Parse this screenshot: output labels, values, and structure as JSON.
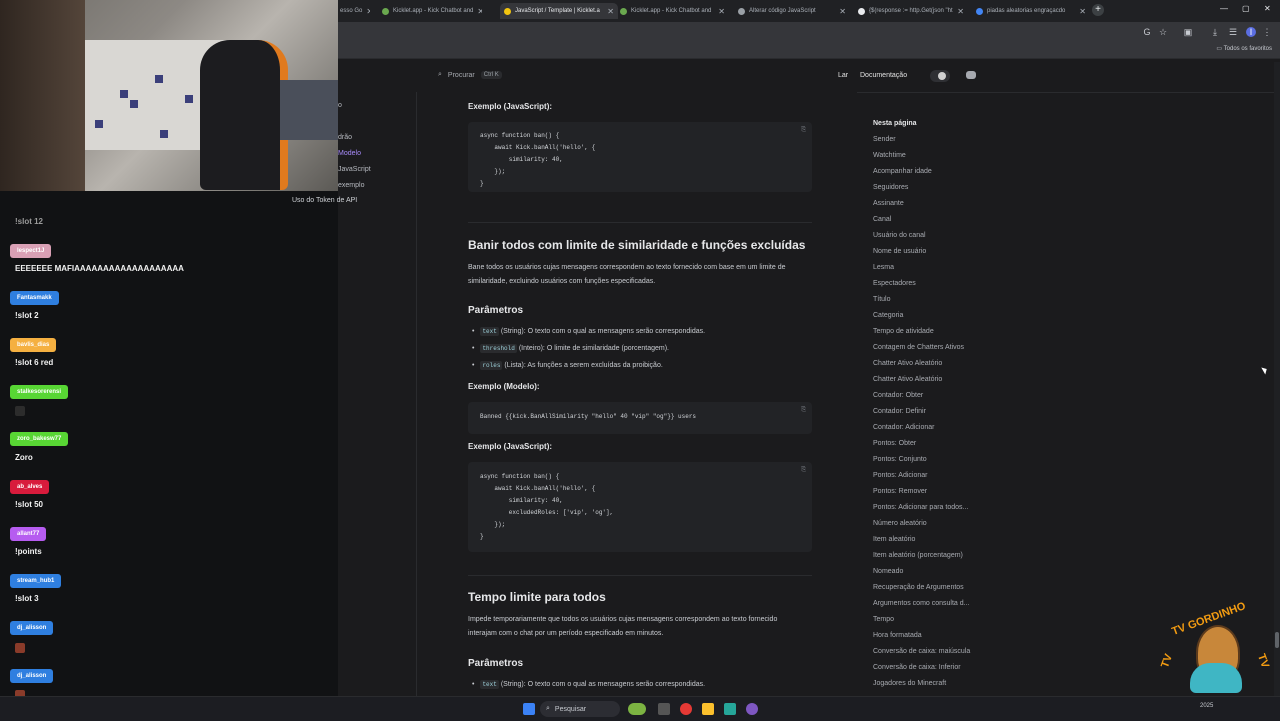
{
  "browser": {
    "tabs": [
      {
        "label": "esso Go"
      },
      {
        "label": "Kicklet.app - Kick Chatbot and"
      },
      {
        "label": "JavaScript / Template | Kicklet.a"
      },
      {
        "label": "Kicklet.app - Kick Chatbot and"
      },
      {
        "label": "Alterar código JavaScript"
      },
      {
        "label": "{$(response := http.Get(json \"ht"
      },
      {
        "label": "piadas aleatorias engraçacdo"
      }
    ],
    "new_tab": "+",
    "window_controls": {
      "minimize": "—",
      "maximize": "▢",
      "close": "✕"
    },
    "bookmarks_all": "Todos os favoritos"
  },
  "header": {
    "search_label": "Procurar",
    "search_shortcut": "Ctrl K",
    "nav_home": "Lar",
    "nav_docs": "Documentação"
  },
  "sidenav": {
    "items": [
      {
        "label": "o"
      },
      {
        "label": "drão"
      },
      {
        "label": "Modelo"
      },
      {
        "label": "JavaScript"
      },
      {
        "label": "exemplo"
      },
      {
        "label": "Uso do Token de API"
      }
    ]
  },
  "chat": {
    "entries": [
      {
        "user": "",
        "message": "!slot 12",
        "color": "#8a8a8a"
      },
      {
        "user": "lespect1J",
        "message": "EEEEEEE MAFIAAAAAAAAAAAAAAAAAAA",
        "color": "#d9a0b5"
      },
      {
        "user": "Fantasmakk",
        "message": "!slot 2",
        "color": "#2f7fe0"
      },
      {
        "user": "bavlis_dias",
        "message": "!slot 6 red",
        "color": "#f5b041"
      },
      {
        "user": "stalkesorerensi",
        "message": "",
        "color": "#58d634"
      },
      {
        "user": "zoro_bakesw77",
        "message": "Zoro",
        "color": "#58d634"
      },
      {
        "user": "ab_alves",
        "message": "!slot 50",
        "color": "#d81b3c"
      },
      {
        "user": "allant77",
        "message": "!points",
        "color": "#b65cf0"
      },
      {
        "user": "stream_hub1",
        "message": "!slot 3",
        "color": "#2f7fe0"
      },
      {
        "user": "dj_alisson",
        "message": "",
        "color": "#2f7fe0"
      },
      {
        "user": "dj_alisson",
        "message": "",
        "color": "#2f7fe0"
      }
    ]
  },
  "docs": {
    "ex1_title": "Exemplo (JavaScript):",
    "ex1_code": [
      "async function ban() {",
      "    await Kick.banAll('hello', {",
      "        similarity: 40,",
      "    });",
      "}"
    ],
    "sec2_title": "Banir todos com limite de similaridade e funções excluídas",
    "sec2_desc": "Bane todos os usuários cujas mensagens correspondem ao texto fornecido com base em um limite de similaridade, excluindo usuários com funções especificadas.",
    "params_title": "Parâmetros",
    "params": [
      {
        "code": "text",
        "text": "(String): O texto com o qual as mensagens serão correspondidas."
      },
      {
        "code": "threshold",
        "text": "(Inteiro): O limite de similaridade (porcentagem)."
      },
      {
        "code": "roles",
        "text": "(Lista): As funções a serem excluídas da proibição."
      }
    ],
    "ex_model_title": "Exemplo (Modelo):",
    "ex_model_code": "Banned {{kick.BanAllSimilarity \"hello\" 40 \"vip\" \"og\"}} users",
    "ex2_title": "Exemplo (JavaScript):",
    "ex2_code": [
      "async function ban() {",
      "    await Kick.banAll('hello', {",
      "        similarity: 40,",
      "        excludedRoles: ['vip', 'og'],",
      "    });",
      "}"
    ],
    "sec3_title": "Tempo limite para todos",
    "sec3_desc": "Impede temporariamente que todos os usuários cujas mensagens correspondem ao texto fornecido interajam com o chat por um período especificado em minutos.",
    "params3_title": "Parâmetros",
    "params3": [
      {
        "code": "text",
        "text": "(String): O texto com o qual as mensagens serão correspondidas."
      }
    ],
    "copy_icon": "⎘"
  },
  "toc": {
    "title": "Nesta página",
    "items": [
      "Sender",
      "Watchtime",
      "Acompanhar idade",
      "Seguidores",
      "Assinante",
      "Canal",
      "Usuário do canal",
      "Nome de usuário",
      "Lesma",
      "Espectadores",
      "Título",
      "Categoria",
      "Tempo de atividade",
      "Contagem de Chatters Ativos",
      "Chatter Ativo Aleatório",
      "Chatter Ativo Aleatório",
      "Contador: Obter",
      "Contador: Definir",
      "Contador: Adicionar",
      "Pontos: Obter",
      "Pontos: Conjunto",
      "Pontos: Adicionar",
      "Pontos: Remover",
      "Pontos: Adicionar para todos...",
      "Número aleatório",
      "Item aleatório",
      "Item aleatório (porcentagem)",
      "Nomeado",
      "Recuperação de Argumentos",
      "Argumentos como consulta d...",
      "Tempo",
      "Hora formatada",
      "Conversão de caixa: maiúscula",
      "Conversão de caixa: Inferior",
      "Jogadores do Minecraft"
    ]
  },
  "logo": {
    "top": "TV GORDINHO",
    "side_left": "TV",
    "side_right": "TV"
  },
  "taskbar": {
    "search": "Pesquisar",
    "time": "2025"
  }
}
